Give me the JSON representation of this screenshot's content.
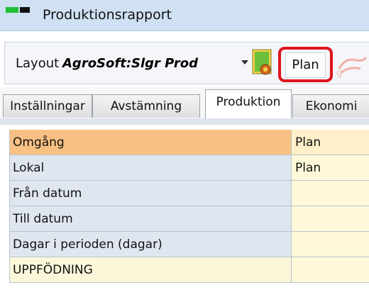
{
  "window": {
    "title": "Produktionsrapport",
    "app_icon": "app-window-icon"
  },
  "toolbar": {
    "layout_label": "Layout",
    "layout_value": "AgroSoft:Slgr Prod",
    "plan_button_label": "Plan",
    "highlight_color": "#e0141c"
  },
  "tabs": [
    {
      "label": "Inställningar",
      "active": false
    },
    {
      "label": "Avstämning",
      "active": false
    },
    {
      "label": "Produktion",
      "active": true
    },
    {
      "label": "Ekonomi",
      "active": false
    }
  ],
  "grid": {
    "rows": [
      {
        "label": "Omgång",
        "value": "Plan",
        "state": "selected"
      },
      {
        "label": "Lokal",
        "value": "Plan",
        "state": "normal"
      },
      {
        "label": "Från datum",
        "value": "",
        "state": "normal"
      },
      {
        "label": "Till datum",
        "value": "",
        "state": "normal"
      },
      {
        "label": "Dagar i perioden (dagar)",
        "value": "",
        "state": "normal"
      },
      {
        "label": "UPPFÖDNING",
        "value": "",
        "state": "section"
      }
    ]
  }
}
